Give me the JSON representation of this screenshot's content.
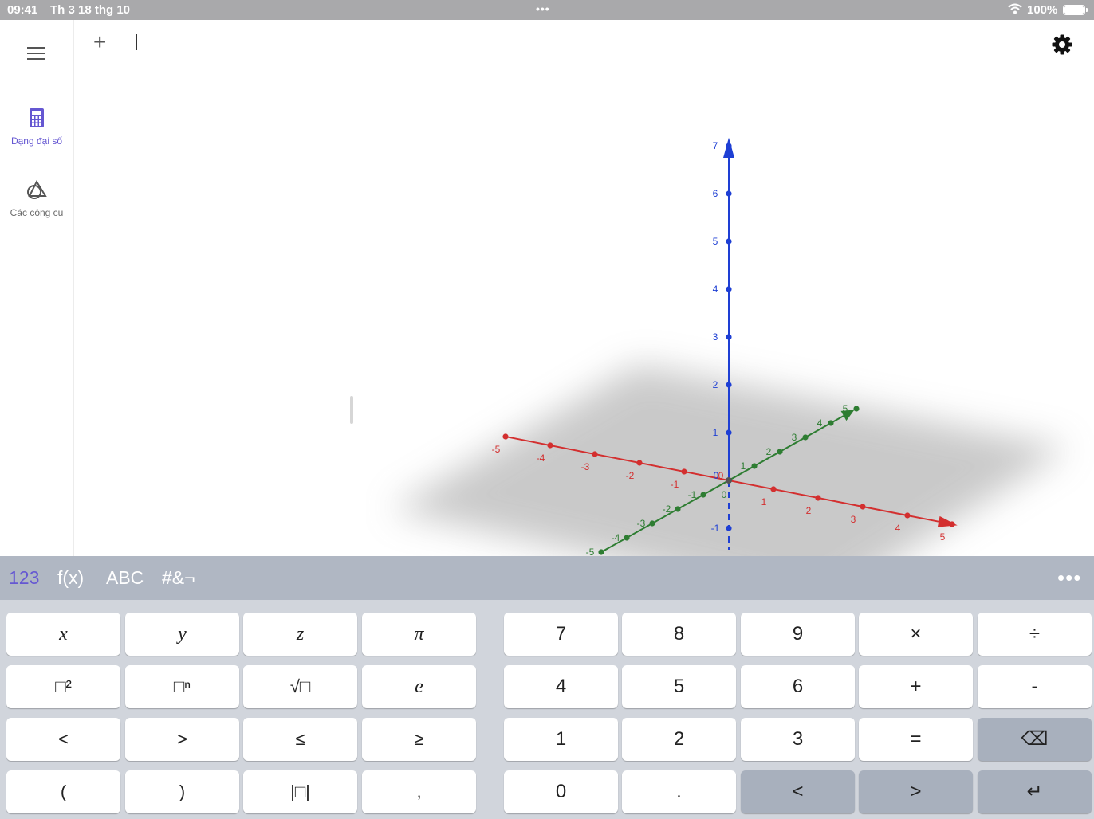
{
  "status_bar": {
    "time": "09:41",
    "date": "Th 3 18 thg 10",
    "battery": "100%",
    "dots": "•••"
  },
  "rail": {
    "menu_icon": "hamburger-icon",
    "algebra_label": "Dạng đại số",
    "tools_label": "Các công cụ"
  },
  "algebra": {
    "add_label": "+"
  },
  "graphics": {
    "axes": {
      "x_color": "#d32f2f",
      "y_color": "#2e7d32",
      "z_color": "#1e3fd4",
      "x_ticks": [
        "-5",
        "-4",
        "-3",
        "-2",
        "-1",
        "0",
        "1",
        "2",
        "3",
        "4",
        "5"
      ],
      "y_ticks": [
        "-5",
        "-4",
        "-3",
        "-2",
        "-1",
        "0",
        "1",
        "2",
        "3",
        "4",
        "5"
      ],
      "z_ticks": [
        "-1",
        "0",
        "1",
        "2",
        "3",
        "4",
        "5",
        "6",
        "7"
      ]
    }
  },
  "keyboard": {
    "tabs": [
      "123",
      "f(x)",
      "ABC",
      "#&¬"
    ],
    "active_tab": "123",
    "active_color": "#6557d2",
    "more": "•••",
    "rows_left": [
      [
        "x",
        "y",
        "z",
        "π"
      ],
      [
        "□²",
        "□ⁿ",
        "√□",
        "e"
      ],
      [
        "<",
        ">",
        "≤",
        "≥"
      ],
      [
        "(",
        ")",
        "|□|",
        ","
      ]
    ],
    "rows_right": [
      [
        "7",
        "8",
        "9",
        "×",
        "÷"
      ],
      [
        "4",
        "5",
        "6",
        "+",
        "-"
      ],
      [
        "1",
        "2",
        "3",
        "=",
        "⌫"
      ],
      [
        "0",
        ".",
        "<",
        ">",
        "↵"
      ]
    ]
  }
}
